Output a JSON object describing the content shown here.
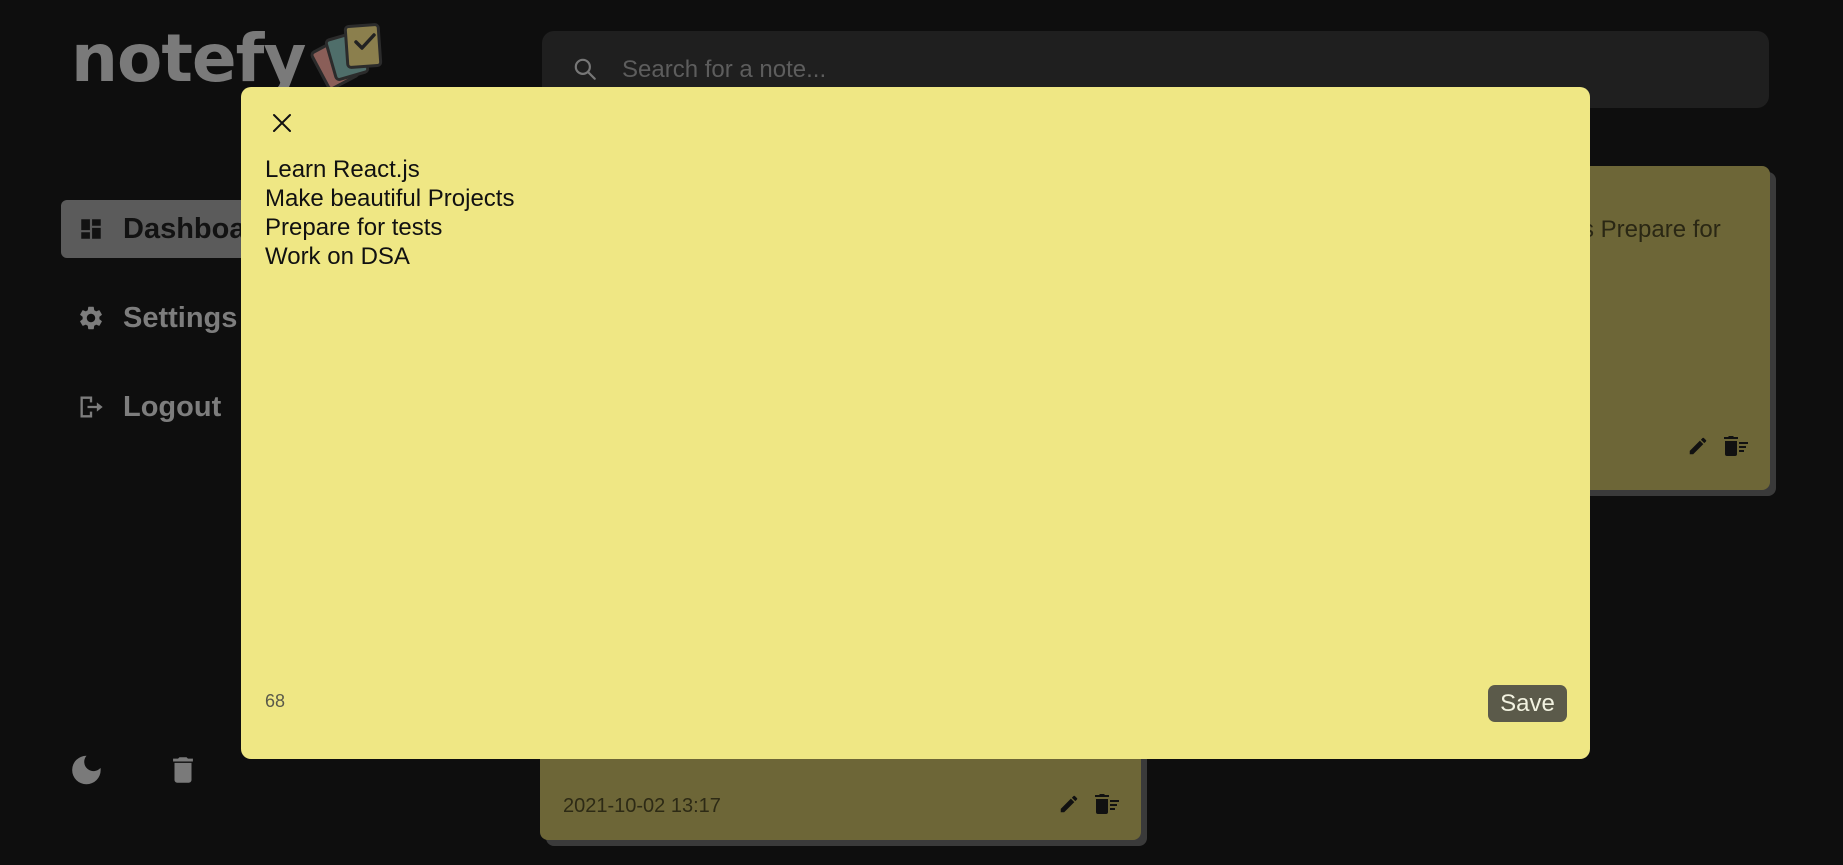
{
  "app": {
    "name": "notefy"
  },
  "sidebar": {
    "items": [
      {
        "label": "Dashboard",
        "icon": "dashboard-icon",
        "active": true
      },
      {
        "label": "Settings",
        "icon": "gear-icon",
        "active": false
      },
      {
        "label": "Logout",
        "icon": "logout-icon",
        "active": false
      }
    ],
    "bottom_icons": [
      "moon-icon",
      "trash-icon"
    ]
  },
  "search": {
    "placeholder": "Search for a note..."
  },
  "notes": [
    {
      "peek_text": "s Prepare for"
    },
    {
      "date": "2021-10-02 13:17"
    }
  ],
  "modal": {
    "content": "Learn React.js\nMake beautiful Projects\nPrepare for tests\nWork on DSA",
    "char_count": "68",
    "save_label": "Save",
    "background_color": "#efe784"
  },
  "colors": {
    "background": "#0e0e0e",
    "note_dimmed": "#6d6637",
    "save_button": "#5b5a4a"
  }
}
